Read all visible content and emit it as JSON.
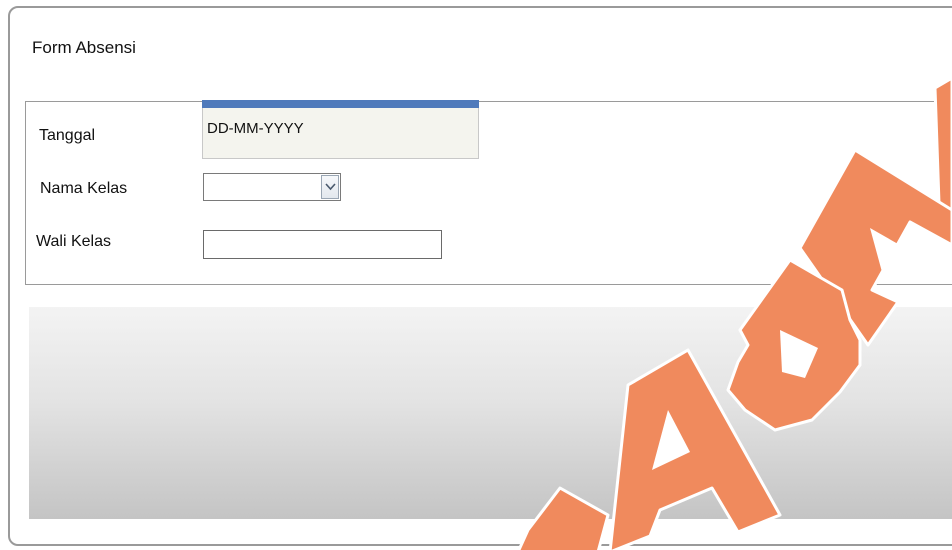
{
  "form": {
    "title": "Form Absensi",
    "fields": {
      "tanggal": {
        "label": "Tanggal",
        "value": "DD-MM-YYYY"
      },
      "nama_kelas": {
        "label": "Nama Kelas",
        "selected": ""
      },
      "wali_kelas": {
        "label": "Wali Kelas",
        "value": ""
      }
    }
  },
  "colors": {
    "date_header_bar": "#4f7abb",
    "watermark": "#f08a5d"
  },
  "icons": {
    "dropdown": "chevron-down-icon"
  }
}
